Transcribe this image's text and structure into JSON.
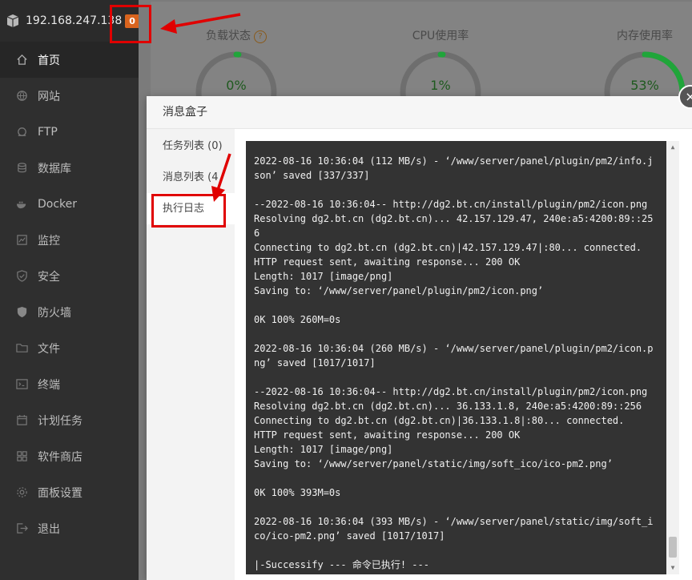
{
  "sidebar": {
    "server_address": "192.168.247.138",
    "message_count": "0",
    "items": [
      {
        "label": "首页",
        "icon": "home-icon"
      },
      {
        "label": "网站",
        "icon": "globe-icon"
      },
      {
        "label": "FTP",
        "icon": "ftp-icon"
      },
      {
        "label": "数据库",
        "icon": "database-icon"
      },
      {
        "label": "Docker",
        "icon": "docker-icon"
      },
      {
        "label": "监控",
        "icon": "monitor-icon"
      },
      {
        "label": "安全",
        "icon": "shield-icon"
      },
      {
        "label": "防火墙",
        "icon": "firewall-icon"
      },
      {
        "label": "文件",
        "icon": "folder-icon"
      },
      {
        "label": "终端",
        "icon": "terminal-icon"
      },
      {
        "label": "计划任务",
        "icon": "calendar-icon"
      },
      {
        "label": "软件商店",
        "icon": "grid-icon"
      },
      {
        "label": "面板设置",
        "icon": "gear-icon"
      },
      {
        "label": "退出",
        "icon": "logout-icon"
      }
    ]
  },
  "stats": {
    "load": {
      "title": "负载状态",
      "value": "0%",
      "fraction": 0.0
    },
    "cpu": {
      "title": "CPU使用率",
      "value": "1%",
      "fraction": 0.01
    },
    "memory": {
      "title": "内存使用率",
      "value": "53%",
      "fraction": 0.53
    }
  },
  "colors": {
    "gauge_ok": "#20a53a",
    "annotation": "#e00000",
    "badge": "#d9641e"
  },
  "modal": {
    "title": "消息盒子",
    "close_label": "×",
    "menu": [
      {
        "label": "任务列表 (0)"
      },
      {
        "label": "消息列表 (4"
      },
      {
        "label": "执行日志"
      }
    ],
    "log": "2022-08-16 10:36:04 (112 MB/s) - ‘/www/server/panel/plugin/pm2/info.json’ saved [337/337]\n\n--2022-08-16 10:36:04-- http://dg2.bt.cn/install/plugin/pm2/icon.png\nResolving dg2.bt.cn (dg2.bt.cn)... 42.157.129.47, 240e:a5:4200:89::256\nConnecting to dg2.bt.cn (dg2.bt.cn)|42.157.129.47|:80... connected.\nHTTP request sent, awaiting response... 200 OK\nLength: 1017 [image/png]\nSaving to: ‘/www/server/panel/plugin/pm2/icon.png’\n\n0K 100% 260M=0s\n\n2022-08-16 10:36:04 (260 MB/s) - ‘/www/server/panel/plugin/pm2/icon.png’ saved [1017/1017]\n\n--2022-08-16 10:36:04-- http://dg2.bt.cn/install/plugin/pm2/icon.png\nResolving dg2.bt.cn (dg2.bt.cn)... 36.133.1.8, 240e:a5:4200:89::256\nConnecting to dg2.bt.cn (dg2.bt.cn)|36.133.1.8|:80... connected.\nHTTP request sent, awaiting response... 200 OK\nLength: 1017 [image/png]\nSaving to: ‘/www/server/panel/static/img/soft_ico/ico-pm2.png’\n\n0K 100% 393M=0s\n\n2022-08-16 10:36:04 (393 MB/s) - ‘/www/server/panel/static/img/soft_ico/ico-pm2.png’ saved [1017/1017]\n\n|-Successify --- 命令已执行! ---"
  }
}
